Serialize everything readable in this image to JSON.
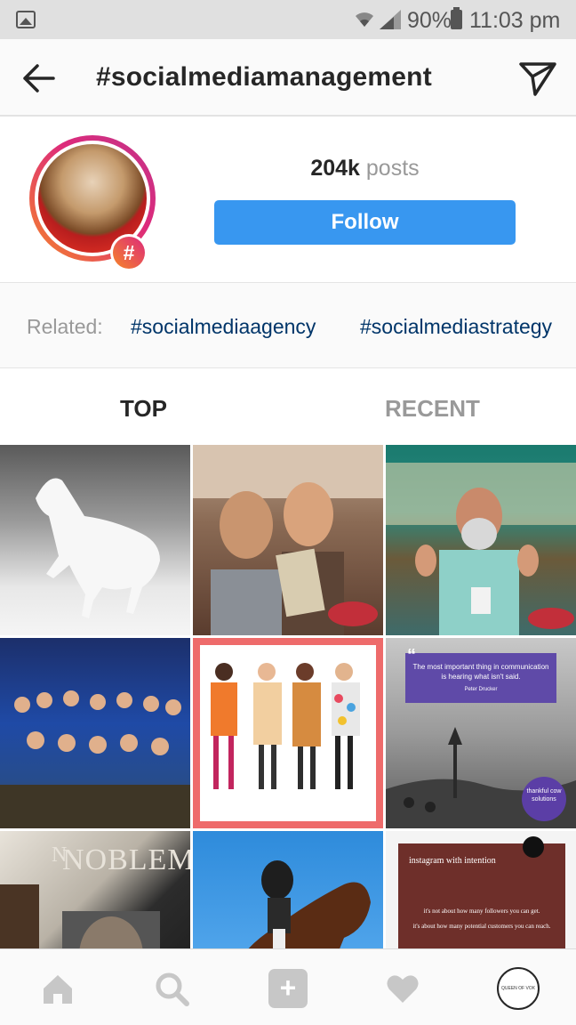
{
  "status_bar": {
    "battery": "90%",
    "time": "11:03 pm"
  },
  "header": {
    "title": "#socialmediamanagement"
  },
  "profile": {
    "hash_symbol": "#",
    "post_count": "204k",
    "post_label": "posts",
    "follow_label": "Follow"
  },
  "related": {
    "label": "Related:",
    "tags": [
      "#socialmediaagency",
      "#socialmediastrategy"
    ]
  },
  "tabs": {
    "top": "TOP",
    "recent": "RECENT"
  },
  "grid": {
    "quote_tile": {
      "text": "The most important thing in communication is hearing what isn't said.",
      "author": "Peter Drucker",
      "badge": "thankful cow solutions"
    },
    "magazine_tile": {
      "title_left": "N",
      "title": "NOBLEMA"
    },
    "insta_tile": {
      "heading": "instagram with intention",
      "line1": "it's not about how many followers you can get.",
      "line2": "it's about how many potential customers you can reach."
    }
  },
  "bottom_nav": {
    "add_symbol": "+",
    "profile_text": "QUEEN OF VOICES"
  },
  "colors": {
    "follow_button": "#3897f0",
    "related_tag": "#003569",
    "inactive_tab": "#999999"
  },
  "icons": {
    "status_bar": [
      "gallery-icon",
      "wifi-icon",
      "signal-icon",
      "battery-icon"
    ],
    "header": [
      "back-arrow-icon",
      "send-icon"
    ],
    "bottom_nav": [
      "home-icon",
      "search-icon",
      "add-icon",
      "heart-icon",
      "profile-avatar"
    ]
  }
}
